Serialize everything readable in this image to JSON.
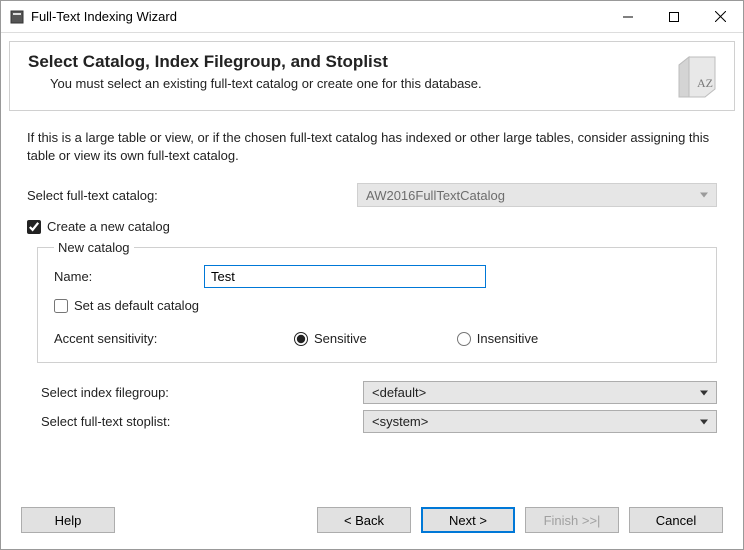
{
  "window": {
    "title": "Full-Text Indexing Wizard"
  },
  "banner": {
    "heading": "Select Catalog, Index Filegroup, and Stoplist",
    "sub": "You must select an existing full-text catalog or create one for this database."
  },
  "advice": "If this is a large table or view, or if the chosen full-text catalog has indexed or other large tables, consider assigning this table or view its own full-text catalog.",
  "catalog": {
    "label": "Select full-text catalog:",
    "value": "AW2016FullTextCatalog",
    "create_label": "Create a new catalog"
  },
  "newcat": {
    "legend": "New catalog",
    "name_label": "Name:",
    "name_value": "Test",
    "default_label": "Set as default catalog",
    "accent_label": "Accent sensitivity:",
    "opt_sensitive": "Sensitive",
    "opt_insensitive": "Insensitive"
  },
  "filegroup": {
    "label": "Select index filegroup:",
    "value": "<default>"
  },
  "stoplist": {
    "label": "Select full-text stoplist:",
    "value": "<system>"
  },
  "buttons": {
    "help": "Help",
    "back": "< Back",
    "next": "Next >",
    "finish": "Finish >>|",
    "cancel": "Cancel"
  }
}
